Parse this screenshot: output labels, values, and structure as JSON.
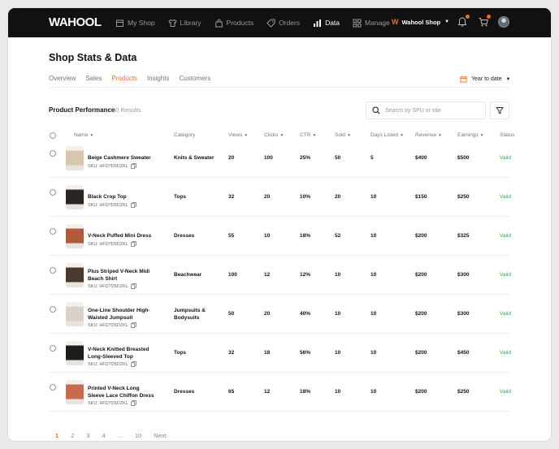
{
  "brand": {
    "logo": "WAHOOL",
    "accent": "#f26b21",
    "status_color": "#3aa34a"
  },
  "nav": [
    {
      "label": "My Shop",
      "icon": "shop-icon"
    },
    {
      "label": "Library",
      "icon": "shirt-icon"
    },
    {
      "label": "Products",
      "icon": "bag-icon"
    },
    {
      "label": "Orders",
      "icon": "tag-icon"
    },
    {
      "label": "Data",
      "icon": "bar-chart-icon",
      "active": true
    },
    {
      "label": "Manage",
      "icon": "grid-icon"
    }
  ],
  "shop_selector": {
    "mark": "W",
    "label": "Wahool Shop"
  },
  "page": {
    "title": "Shop Stats & Data"
  },
  "tabs": [
    {
      "label": "Overview"
    },
    {
      "label": "Sales"
    },
    {
      "label": "Products",
      "active": true
    },
    {
      "label": "Insights"
    },
    {
      "label": "Customers"
    }
  ],
  "date_range": {
    "label": "Year to date"
  },
  "section": {
    "title": "Product Performance",
    "count": "60 Results"
  },
  "search": {
    "placeholder": "Search by SPU or title"
  },
  "columns": [
    "Name",
    "Category",
    "Views",
    "Clicks",
    "CTR",
    "Sold",
    "Days Listed",
    "Revenue",
    "Earnings",
    "Status"
  ],
  "rows": [
    {
      "name": "Beige Cashmere Sweater",
      "sku": "SKU: HFD7D5DZKL",
      "category": "Knits & Sweater",
      "views": "20",
      "clicks": "100",
      "ctr": "25%",
      "sold": "50",
      "days": "5",
      "revenue": "$400",
      "earnings": "$500",
      "status": "Valid",
      "thumb_color": "#d9c7ad"
    },
    {
      "name": "Black Crop Top",
      "sku": "SKU: HFD7D5DZKL",
      "category": "Tops",
      "views": "32",
      "clicks": "20",
      "ctr": "10%",
      "sold": "20",
      "days": "10",
      "revenue": "$150",
      "earnings": "$250",
      "status": "Valid",
      "thumb_color": "#2a2624"
    },
    {
      "name": "V-Neck Puffed Mini Dress",
      "sku": "SKU: HFD7D5DZKL",
      "category": "Dresses",
      "views": "55",
      "clicks": "10",
      "ctr": "18%",
      "sold": "52",
      "days": "10",
      "revenue": "$200",
      "earnings": "$325",
      "status": "Valid",
      "thumb_color": "#b25a3c"
    },
    {
      "name": "Plus Striped V-Neck Midi Beach Shirt",
      "sku": "SKU: HFD7D5DZKL",
      "category": "Beachwear",
      "views": "100",
      "clicks": "12",
      "ctr": "12%",
      "sold": "10",
      "days": "10",
      "revenue": "$200",
      "earnings": "$300",
      "status": "Valid",
      "thumb_color": "#4a3a2e"
    },
    {
      "name": "One-Line Shoulder High-Waisted Jumpsuit",
      "sku": "SKU: HFD7D5DZKL",
      "category": "Jumpsuits & Bodysuits",
      "views": "50",
      "clicks": "20",
      "ctr": "40%",
      "sold": "10",
      "days": "10",
      "revenue": "$200",
      "earnings": "$300",
      "status": "Valid",
      "thumb_color": "#d8d2c8"
    },
    {
      "name": "V-Neck Knitted Breasted Long-Sleeved Top",
      "sku": "SKU: HFD7D5DZKL",
      "category": "Tops",
      "views": "32",
      "clicks": "18",
      "ctr": "56%",
      "sold": "10",
      "days": "10",
      "revenue": "$200",
      "earnings": "$450",
      "status": "Valid",
      "thumb_color": "#1f1c1c"
    },
    {
      "name": "Printed V-Neck Long Sleeve Lace Chiffon Dress",
      "sku": "SKU: HFD7D5DZKL",
      "category": "Dresses",
      "views": "65",
      "clicks": "12",
      "ctr": "18%",
      "sold": "10",
      "days": "10",
      "revenue": "$200",
      "earnings": "$250",
      "status": "Valid",
      "thumb_color": "#c9694e"
    }
  ],
  "pagination": [
    {
      "label": "1",
      "active": true
    },
    {
      "label": "2"
    },
    {
      "label": "3"
    },
    {
      "label": "4"
    },
    {
      "label": "..."
    },
    {
      "label": "10"
    },
    {
      "label": "Next"
    }
  ]
}
